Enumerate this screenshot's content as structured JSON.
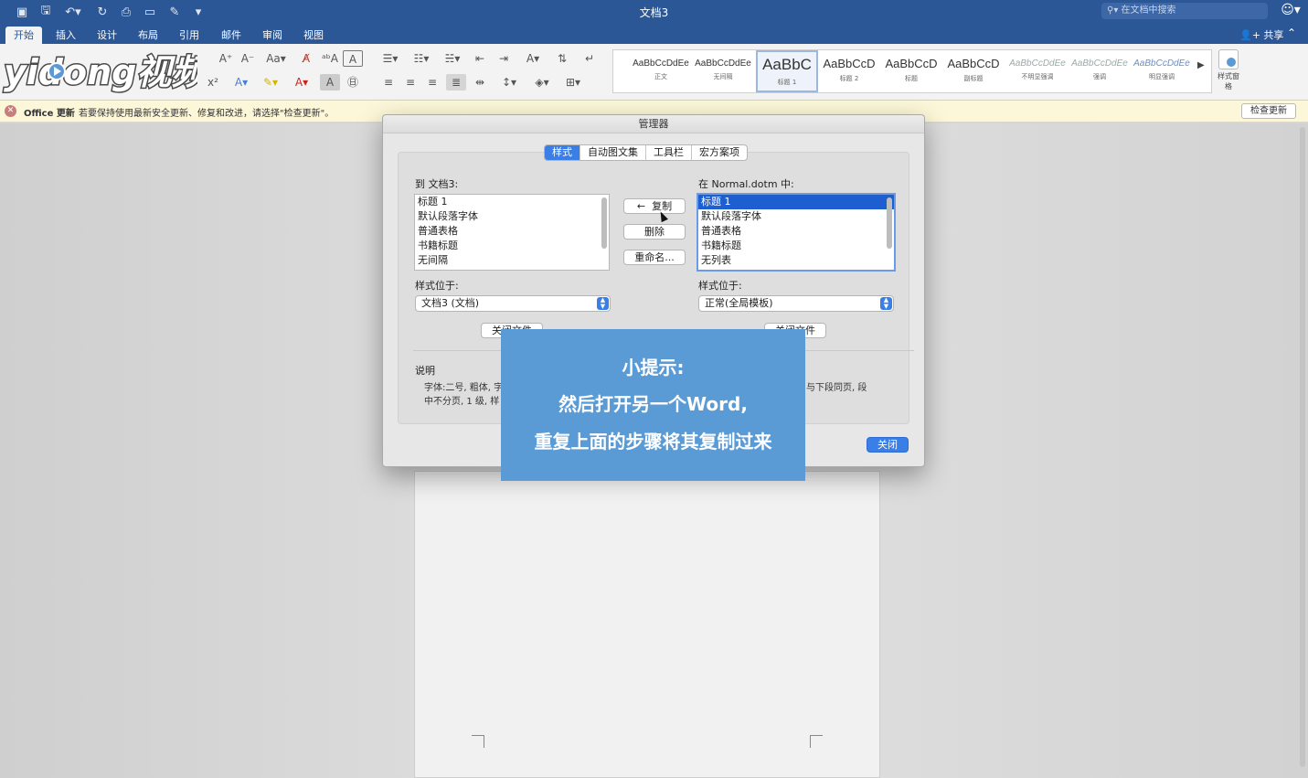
{
  "window": {
    "title": "文档3"
  },
  "search": {
    "placeholder": "在文档中搜索"
  },
  "tabs": [
    "开始",
    "插入",
    "设计",
    "布局",
    "引用",
    "邮件",
    "审阅",
    "视图"
  ],
  "share_label": "共享",
  "styles_gallery": [
    {
      "preview": "AaBbCcDdEe",
      "name": "正文"
    },
    {
      "preview": "AaBbCcDdEe",
      "name": "无间隔"
    },
    {
      "preview": "AaBbC",
      "name": "标题 1"
    },
    {
      "preview": "AaBbCcD",
      "name": "标题 2"
    },
    {
      "preview": "AaBbCcD",
      "name": "标题"
    },
    {
      "preview": "AaBbCcD",
      "name": "副标题"
    },
    {
      "preview": "AaBbCcDdEe",
      "name": "不明显强调"
    },
    {
      "preview": "AaBbCcDdEe",
      "name": "强调"
    },
    {
      "preview": "AaBbCcDdEe",
      "name": "明显强调"
    }
  ],
  "styles_pane_label": "样式窗格",
  "infobar": {
    "title": "Office 更新",
    "message": "若要保持使用最新安全更新、修复和改进，请选择\"检查更新\"。",
    "button": "检查更新"
  },
  "dialog": {
    "title": "管理器",
    "tabs": [
      "样式",
      "自动图文集",
      "工具栏",
      "宏方案项"
    ],
    "active_tab": "样式",
    "left": {
      "header": "到 文档3:",
      "items": [
        "标题 1",
        "默认段落字体",
        "普通表格",
        "书籍标题",
        "无间隔"
      ],
      "styles_in_label": "样式位于:",
      "styles_in_value": "文档3 (文档)",
      "close_file": "关闭文件"
    },
    "right": {
      "header": "在 Normal.dotm 中:",
      "items": [
        "标题 1",
        "默认段落字体",
        "普通表格",
        "书籍标题",
        "无列表"
      ],
      "selected_index": 0,
      "styles_in_label": "样式位于:",
      "styles_in_value": "正常(全局模板)",
      "close_file": "关闭文件"
    },
    "buttons": {
      "copy": "复制",
      "delete": "删除",
      "rename": "重命名..."
    },
    "description_label": "说明",
    "description_left": "字体:二号, 粗体, 字",
    "description_left2": "中不分页, 1 级, 样",
    "description_right": "与下段同页, 段",
    "close_button": "关闭"
  },
  "tip": {
    "line1": "小提示:",
    "line2": "然后打开另一个Word,",
    "line3": "重复上面的步骤将其复制过来"
  },
  "logo_text": "yidong视频",
  "colors": {
    "title_bar": "#2b5797",
    "accent": "#3a7ee8",
    "tip_background": "#5b9bd5",
    "infobar": "#fcf7d8"
  }
}
